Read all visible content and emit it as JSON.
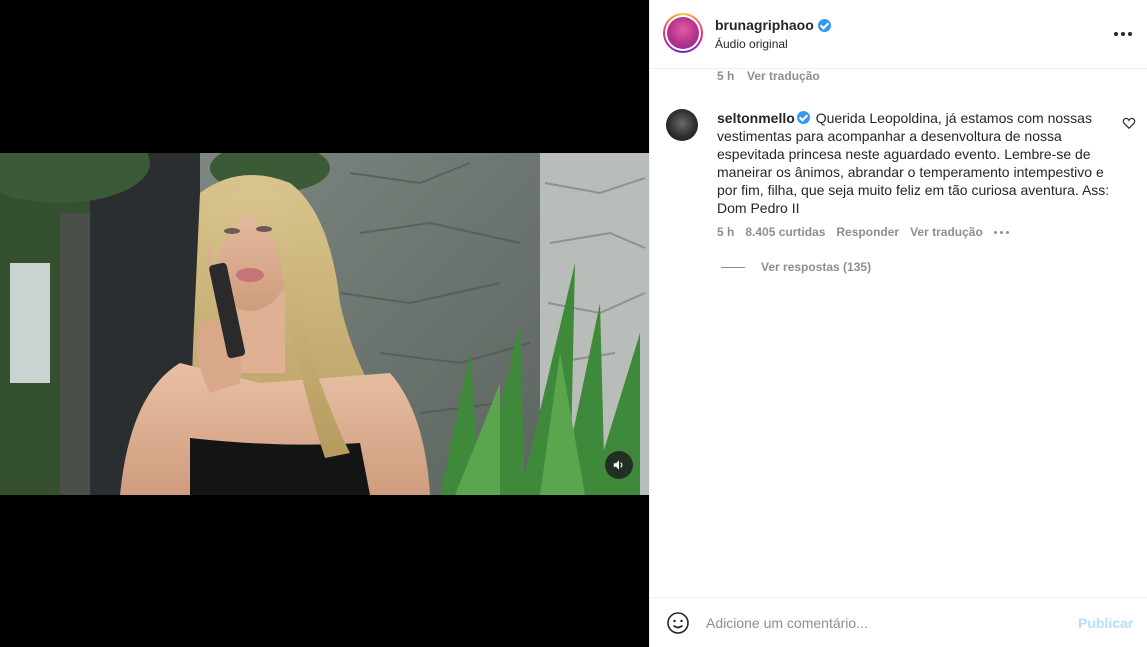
{
  "post": {
    "username": "bruna.griphao",
    "username_display": "brunagriphaoo",
    "audio_label": "Áudio original",
    "caption_time": "5 h",
    "caption_translate": "Ver tradução"
  },
  "comment": {
    "username": "seltonmello",
    "text": "Querida Leopoldina, já estamos com nossas vestimentas para acompanhar a desenvoltura de nossa espevitada princesa neste aguardado evento. Lembre-se de maneirar os ânimos, abrandar o temperamento intempestivo e por fim, filha, que seja muito feliz em tão curiosa aventura. Ass: Dom Pedro II",
    "time": "5 h",
    "likes": "8.405 curtidas",
    "reply_label": "Responder",
    "translate_label": "Ver tradução",
    "view_replies": "Ver respostas (135)"
  },
  "footer": {
    "placeholder": "Adicione um comentário...",
    "publish_label": "Publicar"
  },
  "icons": {
    "sound": "speaker-icon",
    "more": "more-options-icon",
    "like": "heart-icon",
    "emoji": "emoji-icon",
    "verified": "verified-badge-icon"
  },
  "colors": {
    "verified": "#3897f0",
    "muted_text": "#8e8e8e",
    "publish_disabled": "#b2dffc"
  }
}
